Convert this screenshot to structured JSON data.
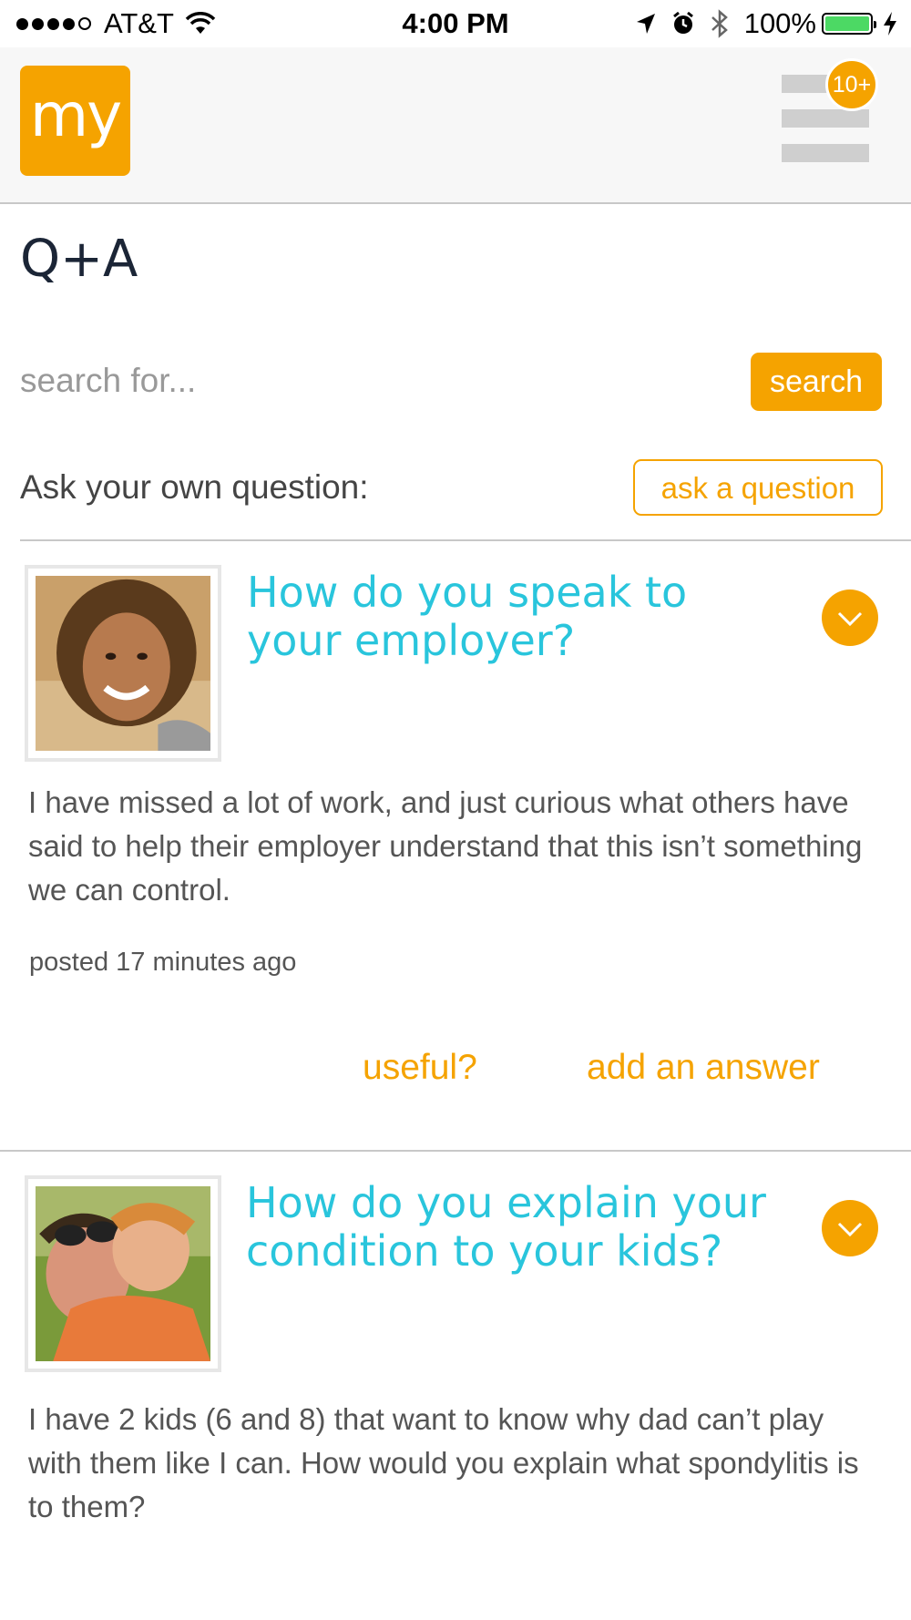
{
  "status_bar": {
    "carrier": "AT&T",
    "time": "4:00 PM",
    "battery": "100%"
  },
  "header": {
    "logo_text": "my",
    "notification_count": "10+"
  },
  "page": {
    "title": "Q+A"
  },
  "search": {
    "placeholder": "search for...",
    "button_label": "search"
  },
  "ask": {
    "label": "Ask your own question:",
    "button_label": "ask a question"
  },
  "questions": [
    {
      "title": "How do you speak to your employer?",
      "body": "I have missed a lot of work, and just curious what others have said to help their employer understand that this isn’t something we can control.",
      "posted": "posted 17 minutes ago",
      "useful_label": "useful?",
      "answer_label": "add an answer"
    },
    {
      "title": "How do you explain your condition to your kids?",
      "body": "I have 2 kids (6 and 8) that want to know why dad can’t play with them like I can.  How would you explain what spondylitis is to them?"
    }
  ],
  "colors": {
    "accent": "#f5a300",
    "question_title": "#29c5dc",
    "page_title": "#1b2536"
  }
}
